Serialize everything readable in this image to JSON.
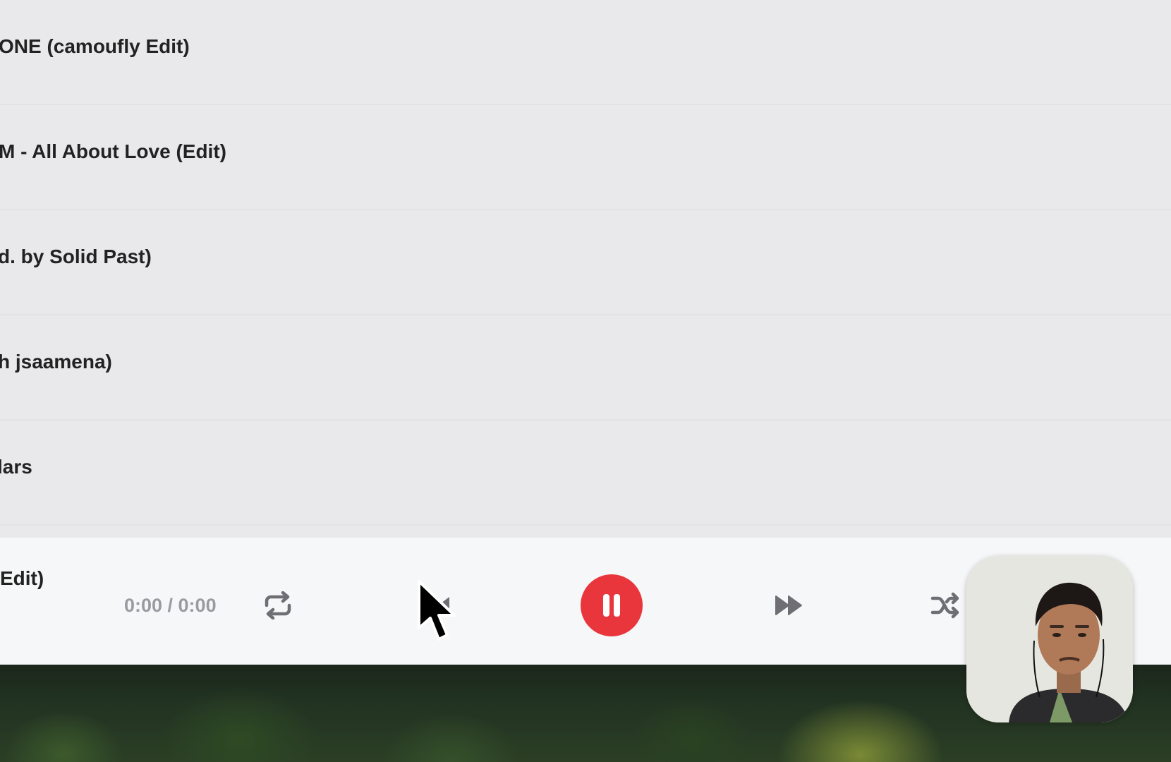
{
  "playlist": {
    "tracks": [
      {
        "title": "ONE (camoufly Edit)"
      },
      {
        "title": "M - All About Love (Edit)"
      },
      {
        "title": "d. by Solid Past)"
      },
      {
        "title": "h jsaamena)"
      },
      {
        "title": "lars"
      }
    ]
  },
  "player": {
    "now_playing_title": "Edit)",
    "time": "0:00 / 0:00",
    "state": "playing",
    "accent_color": "#e9363d",
    "icons": {
      "repeat": "repeat-icon",
      "previous": "previous-icon",
      "pause": "pause-icon",
      "next": "fast-forward-icon",
      "shuffle": "shuffle-icon"
    }
  }
}
